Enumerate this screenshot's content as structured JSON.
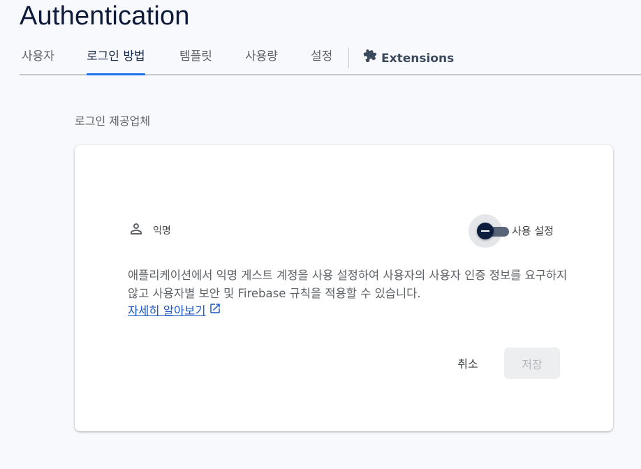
{
  "header": {
    "title": "Authentication"
  },
  "tabs": [
    {
      "label": "사용자",
      "active": false
    },
    {
      "label": "로그인 방법",
      "active": true
    },
    {
      "label": "템플릿",
      "active": false
    },
    {
      "label": "사용량",
      "active": false
    },
    {
      "label": "설정",
      "active": false
    },
    {
      "label": "Extensions",
      "icon": "extensions-puzzle-icon",
      "active": false
    }
  ],
  "main": {
    "section_label": "로그인 제공업체",
    "provider": {
      "icon": "person-icon",
      "name": "익명",
      "toggle_label": "사용 설정",
      "enabled": false
    },
    "description": "애플리케이션에서 익명 게스트 계정을 사용 설정하여 사용자의 사용자 인증 정보를 요구하지 않고 사용자별 보안 및 Firebase 규칙을 적용할 수 있습니다.",
    "learn_more": {
      "label": "자세히 알아보기",
      "icon": "open-in-new-icon"
    },
    "actions": {
      "cancel": "취소",
      "save": "저장"
    }
  },
  "colors": {
    "accent": "#1a73e8",
    "title": "#0d1a3a",
    "link": "#1a56c4",
    "toggle_knob": "#0c1c3d"
  }
}
